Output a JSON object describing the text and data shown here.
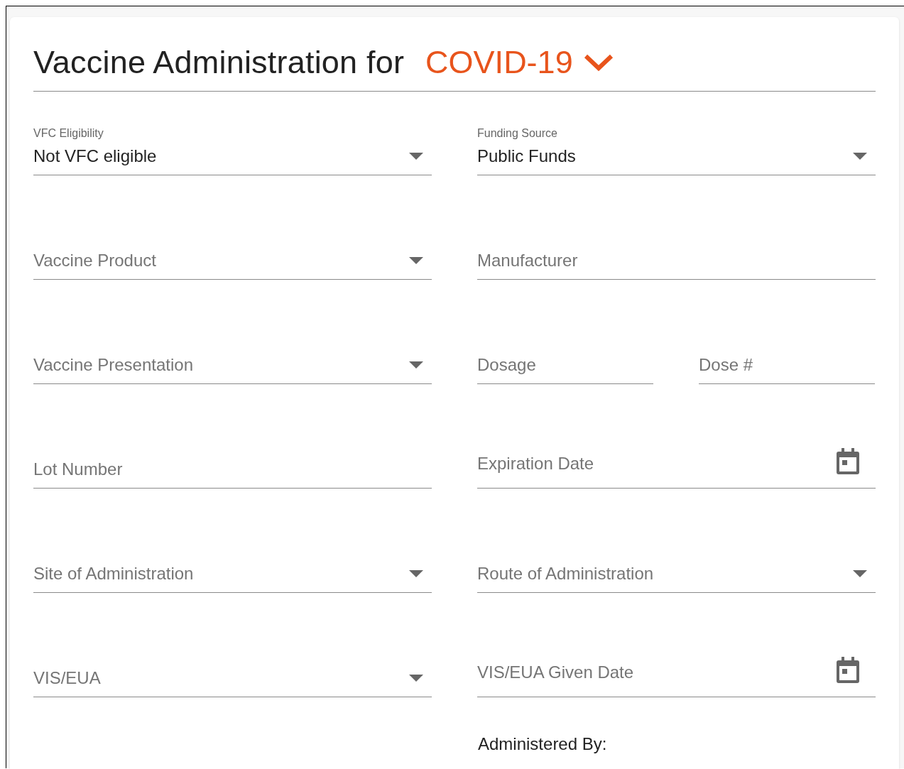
{
  "title": {
    "text": "Vaccine Administration for",
    "vaccine": "COVID-19"
  },
  "rows": [
    [
      {
        "kind": "select",
        "label": "VFC Eligibility",
        "value": "Not VFC eligible"
      },
      {
        "kind": "select",
        "label": "Funding Source",
        "value": "Public Funds"
      }
    ],
    [
      {
        "kind": "select",
        "label": "Vaccine Product"
      },
      {
        "kind": "text",
        "label": "Manufacturer"
      }
    ],
    [
      {
        "kind": "select",
        "label": "Vaccine Presentation"
      },
      {
        "kind": "text",
        "label": "Dosage"
      },
      {
        "kind": "text",
        "label": "Dose #"
      }
    ],
    [
      {
        "kind": "text",
        "label": "Lot Number"
      },
      {
        "kind": "date",
        "label": "Expiration Date"
      }
    ],
    [
      {
        "kind": "select",
        "label": "Site of Administration"
      },
      {
        "kind": "select",
        "label": "Route of Administration"
      }
    ],
    [
      {
        "kind": "select",
        "label": "VIS/EUA"
      },
      {
        "kind": "date",
        "label": "VIS/EUA Given Date"
      }
    ]
  ],
  "administered_by": "Administered By:"
}
